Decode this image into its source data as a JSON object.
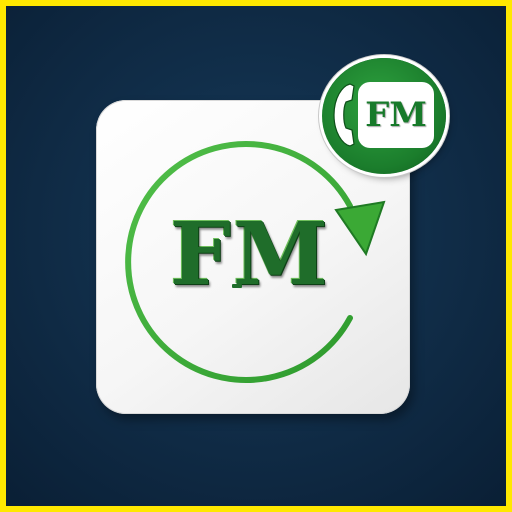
{
  "logo": {
    "main_text": "FM",
    "badge_text": "FM",
    "icons": [
      "refresh-arrow-icon",
      "phone-icon"
    ],
    "colors": {
      "frame": "#ffe800",
      "background": "#0f2a44",
      "tile": "#ffffff",
      "green_dark": "#1f6d2a",
      "green_light": "#3ba935"
    }
  }
}
